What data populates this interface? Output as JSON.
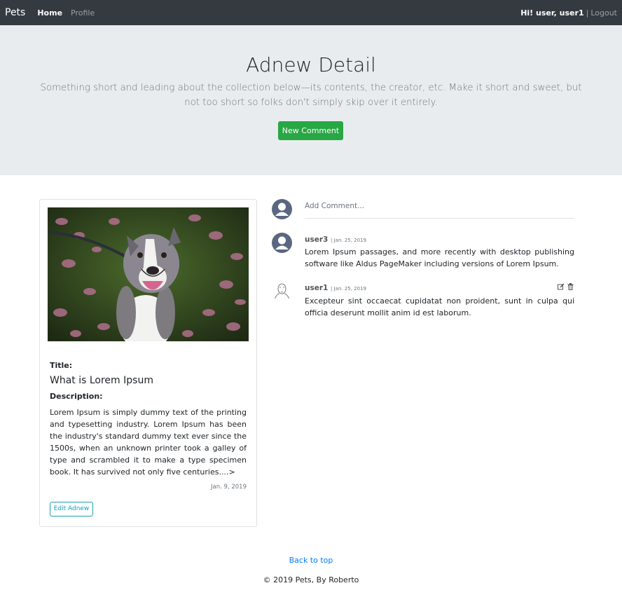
{
  "nav": {
    "brand": "Pets",
    "links": [
      "Home",
      "Profile"
    ],
    "greeting": "Hi! user, user1",
    "separator": "|",
    "logout": "Logout"
  },
  "header": {
    "title": "Adnew Detail",
    "lead": "Something short and leading about the collection below—its contents, the creator, etc. Make it short and sweet, but not too short so folks don't simply skip over it entirely.",
    "button": "New Comment"
  },
  "ad": {
    "title_label": "Title:",
    "title": "What is Lorem Ipsum",
    "description_label": "Description:",
    "description": "Lorem Ipsum is simply dummy text of the printing and typesetting industry. Lorem Ipsum has been the industry's standard dummy text ever since the 1500s, when an unknown printer took a galley of type and scrambled it to make a type specimen book. It has survived not only five centuries....>",
    "date": "Jan. 9, 2019",
    "edit_button": "Edit Adnew"
  },
  "comments": {
    "placeholder": "Add Comment...",
    "items": [
      {
        "user": "user3",
        "date": "| Jan. 25, 2019",
        "text": "Lorem Ipsum passages, and more recently with desktop publishing software like Aldus PageMaker including versions of Lorem Ipsum."
      },
      {
        "user": "user1",
        "date": "| Jan. 25, 2019",
        "text": "Excepteur sint occaecat cupidatat non proident, sunt in culpa qui officia deserunt mollit anim id est laborum."
      }
    ]
  },
  "footer": {
    "back_to_top": "Back to top",
    "copyright": "© 2019 Pets, By Roberto"
  }
}
